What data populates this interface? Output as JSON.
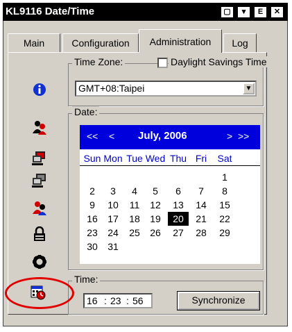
{
  "window": {
    "title": "KL9116 Date/Time"
  },
  "titlebar_buttons": [
    {
      "name": "window-icon",
      "glyph": "▢"
    },
    {
      "name": "pin-icon",
      "glyph": "▼"
    },
    {
      "name": "exit-icon",
      "glyph": "E"
    },
    {
      "name": "close-icon",
      "glyph": "✕"
    }
  ],
  "tabs": [
    {
      "label": "Main",
      "active": false
    },
    {
      "label": "Configuration",
      "active": false
    },
    {
      "label": "Administration",
      "active": true
    },
    {
      "label": "Log",
      "active": false
    }
  ],
  "sidebar_icons": [
    "info-icon",
    "user-management-icon",
    "network-computer-icon",
    "computer-icon",
    "user-security-icon",
    "lock-icon",
    "gear-icon",
    "date-time-icon"
  ],
  "timezone": {
    "legend": "Time Zone:",
    "value": "GMT+08:Taipei"
  },
  "daylight": {
    "label": "Daylight Savings Time",
    "checked": false
  },
  "date": {
    "legend": "Date:",
    "prev_year": "<<",
    "prev_month": "<",
    "month_title": "July, 2006",
    "next_month": ">",
    "next_year": ">>",
    "days_of_week": [
      "Sun",
      "Mon",
      "Tue",
      "Wed",
      "Thu",
      "Fri",
      "Sat"
    ],
    "weeks": [
      [
        "",
        "",
        "",
        "",
        "",
        "",
        "1"
      ],
      [
        "2",
        "3",
        "4",
        "5",
        "6",
        "7",
        "8"
      ],
      [
        "9",
        "10",
        "11",
        "12",
        "13",
        "14",
        "15"
      ],
      [
        "16",
        "17",
        "18",
        "19",
        "20",
        "21",
        "22"
      ],
      [
        "23",
        "24",
        "25",
        "26",
        "27",
        "28",
        "29"
      ],
      [
        "30",
        "31",
        "",
        "",
        "",
        "",
        ""
      ]
    ],
    "selected_day": "20"
  },
  "time": {
    "legend": "Time:",
    "hours": "16",
    "minutes": "23",
    "seconds": "56",
    "separator": ":"
  },
  "sync_button": {
    "label": "Synchronize"
  },
  "colors": {
    "calendar_header": "#0000dd",
    "annotation_circle": "#e00000"
  }
}
